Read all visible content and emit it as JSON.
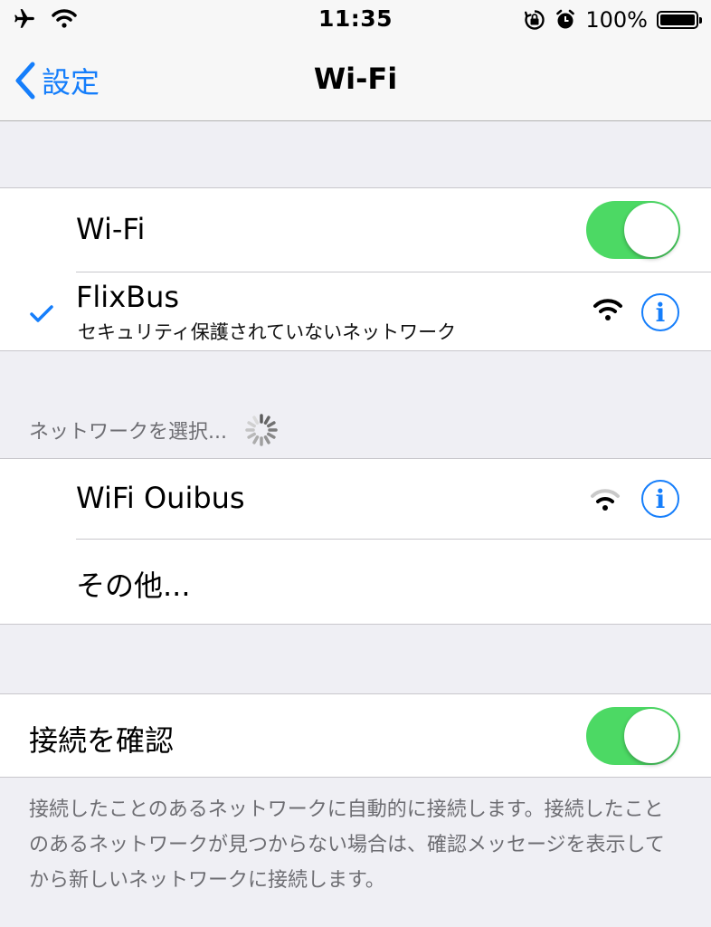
{
  "status_bar": {
    "time": "11:35",
    "battery_percent": "100%",
    "icons": [
      "airplane-icon",
      "wifi-status-icon",
      "orientation-lock-icon",
      "alarm-icon",
      "battery-icon"
    ]
  },
  "nav": {
    "back_label": "設定",
    "title": "Wi-Fi"
  },
  "wifi_section": {
    "wifi_label": "Wi-Fi",
    "wifi_on": true,
    "connected_network": {
      "name": "FlixBus",
      "subtitle": "セキュリティ保護されていないネットワーク",
      "checked": true
    }
  },
  "networks_section": {
    "header": "ネットワークを選択...",
    "networks": [
      {
        "name": "WiFi Ouibus"
      }
    ],
    "other_label": "その他..."
  },
  "ask_join": {
    "label": "接続を確認",
    "on": true,
    "footer": "接続したことのあるネットワークに自動的に接続します。接続したことのあるネットワークが見つからない場合は、確認メッセージを表示してから新しいネットワークに接続します。"
  },
  "colors": {
    "accent": "#157efb",
    "toggle_on": "#4cd964",
    "background": "#efeff4"
  }
}
